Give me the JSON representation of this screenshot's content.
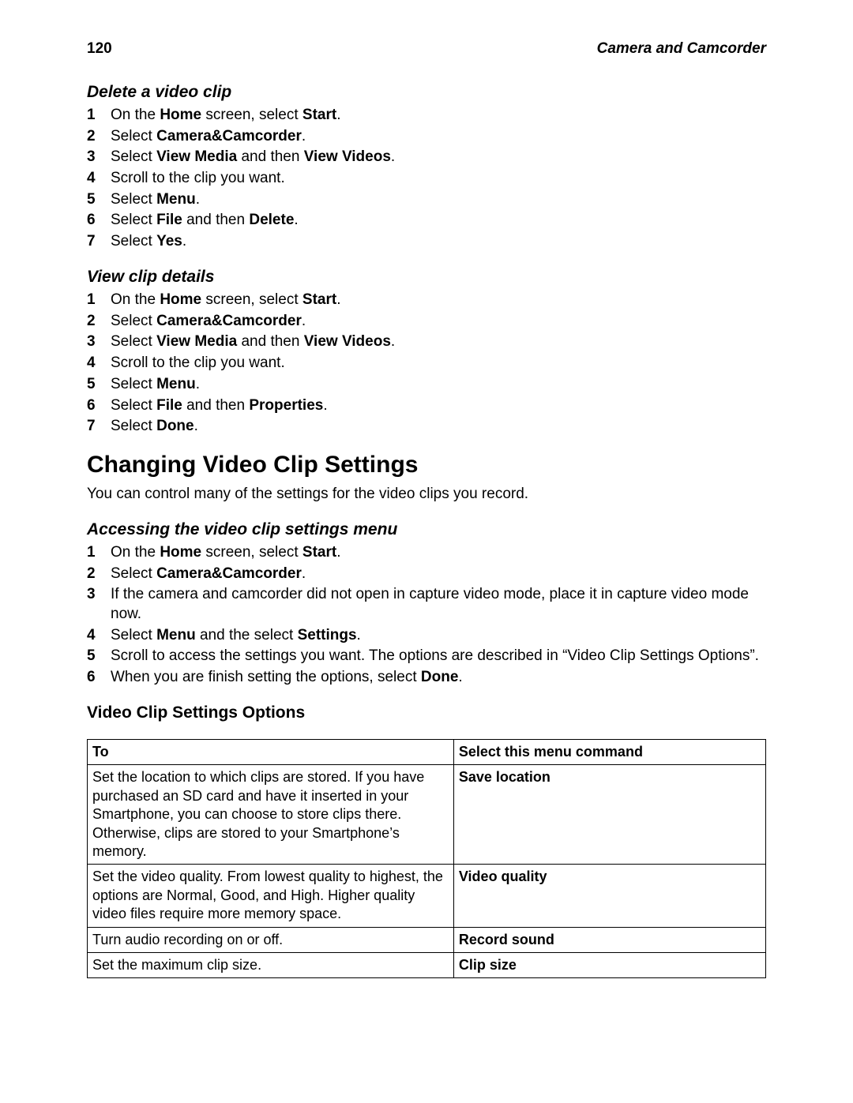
{
  "header": {
    "page_number": "120",
    "chapter": "Camera and Camcorder"
  },
  "sections": [
    {
      "heading": "Delete a video clip",
      "heading_class": "subhead",
      "steps": [
        [
          [
            "On the "
          ],
          [
            "b",
            "Home"
          ],
          [
            " screen, select "
          ],
          [
            "b",
            "Start"
          ],
          [
            "."
          ]
        ],
        [
          [
            "Select "
          ],
          [
            "b",
            "Camera&Camcorder"
          ],
          [
            "."
          ]
        ],
        [
          [
            "Select "
          ],
          [
            "b",
            "View Media"
          ],
          [
            " and then "
          ],
          [
            "b",
            "View Videos"
          ],
          [
            "."
          ]
        ],
        [
          [
            "Scroll to the clip you want."
          ]
        ],
        [
          [
            "Select "
          ],
          [
            "b",
            "Menu"
          ],
          [
            "."
          ]
        ],
        [
          [
            "Select "
          ],
          [
            "b",
            "File"
          ],
          [
            " and then "
          ],
          [
            "b",
            "Delete"
          ],
          [
            "."
          ]
        ],
        [
          [
            "Select "
          ],
          [
            "b",
            "Yes"
          ],
          [
            "."
          ]
        ]
      ]
    },
    {
      "heading": "View clip details",
      "heading_class": "subhead",
      "steps": [
        [
          [
            "On the "
          ],
          [
            "b",
            "Home"
          ],
          [
            " screen, select "
          ],
          [
            "b",
            "Start"
          ],
          [
            "."
          ]
        ],
        [
          [
            "Select "
          ],
          [
            "b",
            "Camera&Camcorder"
          ],
          [
            "."
          ]
        ],
        [
          [
            "Select "
          ],
          [
            "b",
            "View Media"
          ],
          [
            " and then "
          ],
          [
            "b",
            "View Videos"
          ],
          [
            "."
          ]
        ],
        [
          [
            "Scroll to the clip you want."
          ]
        ],
        [
          [
            "Select "
          ],
          [
            "b",
            "Menu"
          ],
          [
            "."
          ]
        ],
        [
          [
            "Select "
          ],
          [
            "b",
            "File"
          ],
          [
            " and then "
          ],
          [
            "b",
            "Properties"
          ],
          [
            "."
          ]
        ],
        [
          [
            "Select "
          ],
          [
            "b",
            "Done"
          ],
          [
            "."
          ]
        ]
      ]
    },
    {
      "heading": "Changing Video Clip Settings",
      "heading_class": "bighead",
      "intro": "You can control many of the settings for the video clips you record."
    },
    {
      "heading": "Accessing the video clip settings menu",
      "heading_class": "subhead",
      "steps": [
        [
          [
            "On the "
          ],
          [
            "b",
            "Home"
          ],
          [
            " screen, select "
          ],
          [
            "b",
            "Start"
          ],
          [
            "."
          ]
        ],
        [
          [
            "Select "
          ],
          [
            "b",
            "Camera&Camcorder"
          ],
          [
            "."
          ]
        ],
        [
          [
            "If the camera and camcorder did not open in capture video mode, place it in capture video mode now."
          ]
        ],
        [
          [
            "Select "
          ],
          [
            "b",
            "Menu"
          ],
          [
            " and the select "
          ],
          [
            "b",
            "Settings"
          ],
          [
            "."
          ]
        ],
        [
          [
            "Scroll to access the settings you want. The options are described in “Video Clip Settings Options”."
          ]
        ],
        [
          [
            "When you are finish setting the options, select "
          ],
          [
            "b",
            "Done"
          ],
          [
            "."
          ]
        ]
      ]
    },
    {
      "heading": "Video Clip Settings Options",
      "heading_class": "boldhead",
      "table": {
        "headers": [
          "To",
          "Select this menu command"
        ],
        "rows": [
          [
            "Set the location to which clips are stored. If you have purchased an SD card and have it inserted in your Smartphone, you can choose to store clips there. Otherwise, clips are stored to your Smartphone’s memory.",
            "Save location"
          ],
          [
            "Set the video quality. From lowest quality to highest, the options are Normal, Good, and High. Higher quality video files require more memory space.",
            "Video quality"
          ],
          [
            "Turn audio recording on or off.",
            "Record sound"
          ],
          [
            "Set the maximum clip size.",
            "Clip size"
          ]
        ]
      }
    }
  ]
}
